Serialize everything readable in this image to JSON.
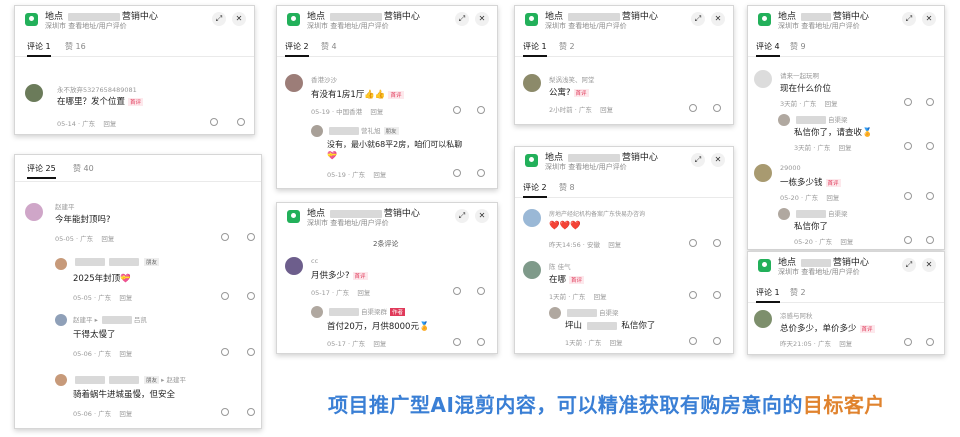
{
  "common": {
    "title_prefix": "地点",
    "title_suffix": "营销中心",
    "city": "深圳市",
    "subtitle": "查看地址/用户评价",
    "expand_icon": "expand-icon",
    "close_icon": "close-icon",
    "reply": "回复",
    "like_icon": "heart-icon",
    "dislike_icon": "broken-heart-icon"
  },
  "card1": {
    "tab_comments": "评论 1",
    "tab_likes": "赞 16",
    "c1": {
      "name": "永不放弃5327658489081",
      "text": "在哪里？发个位置",
      "tag": "首评",
      "time": "05-14",
      "loc": "广东"
    }
  },
  "card2": {
    "tab_comments": "评论 25",
    "tab_likes": "赞 40",
    "c1": {
      "name": "赵建平",
      "text": "今年能封顶吗?",
      "time": "05-05",
      "loc": "广东"
    },
    "c2": {
      "tag": "朋友",
      "text": "2025年封顶💝",
      "time": "05-05",
      "loc": "广东"
    },
    "c3": {
      "name": "赵建平",
      "arrow": "▸",
      "suffix": "吕凯",
      "text": "干得太慢了",
      "time": "05-06",
      "loc": "广东"
    },
    "c4": {
      "tag": "朋友",
      "arrow": "▸",
      "suffix": "赵建平",
      "text": "骑着蜗牛进城虽慢，但安全",
      "time": "05-06",
      "loc": "广东"
    }
  },
  "card3": {
    "tab_comments": "评论 2",
    "tab_likes": "赞 4",
    "c1": {
      "name": "香港沙沙",
      "text": "有没有1房1厅👍👍",
      "tag": "首评",
      "time": "05-19",
      "loc": "中国香港"
    },
    "c2": {
      "name_suffix": "营礼旭",
      "tag": "朋友",
      "text": "没有，最小就68平2房，咱们可以私聊",
      "text2": "💝",
      "time": "05-19",
      "loc": "广东"
    }
  },
  "card4": {
    "count_label": "2条评论",
    "c1": {
      "name": "cc",
      "text": "月供多少?",
      "tag": "首评",
      "time": "05-17",
      "loc": "广东"
    },
    "c2": {
      "name_suffix": "自渠梁群",
      "tag": "作者",
      "text": "首付20万，月供8000元🏅",
      "time": "05-17",
      "loc": "广东"
    }
  },
  "card5": {
    "tab_comments": "评论 1",
    "tab_likes": "赞 2",
    "c1": {
      "name": "梨涡浅笑、阿堂",
      "text": "公寓?",
      "tag": "首评",
      "time": "2小时前",
      "loc": "广东"
    }
  },
  "card6": {
    "tab_comments": "评论 2",
    "tab_likes": "赞 8",
    "c1": {
      "name": "房地产经纪机构备案广东快易办咨询",
      "text": "❤️❤️❤️",
      "time": "昨天14:56",
      "loc": "安徽"
    },
    "c2": {
      "name": "陈 佳气",
      "text": "在哪",
      "tag": "首评",
      "time": "1天前",
      "loc": "广东"
    },
    "c3": {
      "name_suffix": "自渠梁",
      "text": "坪山",
      "text2": "私信你了",
      "time": "1天前",
      "loc": "广东"
    }
  },
  "card7": {
    "tab_comments": "评论 4",
    "tab_likes": "赞 9",
    "c1": {
      "name": "请来一起玩啊",
      "text": "现在什么价位",
      "time": "3天前",
      "loc": "广东"
    },
    "c2": {
      "name_suffix": "自渠梁",
      "text": "私信你了，请查收🏅",
      "time": "3天前",
      "loc": "广东"
    },
    "c3": {
      "name": "29000",
      "text": "一栋多少钱",
      "tag": "首评",
      "time": "05-20",
      "loc": "广东"
    },
    "c4": {
      "name_suffix": "自渠梁",
      "text": "私信你了",
      "time": "05-20",
      "loc": "广东"
    }
  },
  "card8": {
    "tab_comments": "评论 1",
    "tab_likes": "赞 2",
    "c1": {
      "name": "凉感与阿秋",
      "text": "总价多少，单价多少",
      "tag": "首评",
      "time": "昨天21:05",
      "loc": "广东"
    }
  },
  "caption": {
    "part1": "项目推广型AI混剪内容，可以精准获取有购房意向的",
    "part2": "目标客户"
  }
}
